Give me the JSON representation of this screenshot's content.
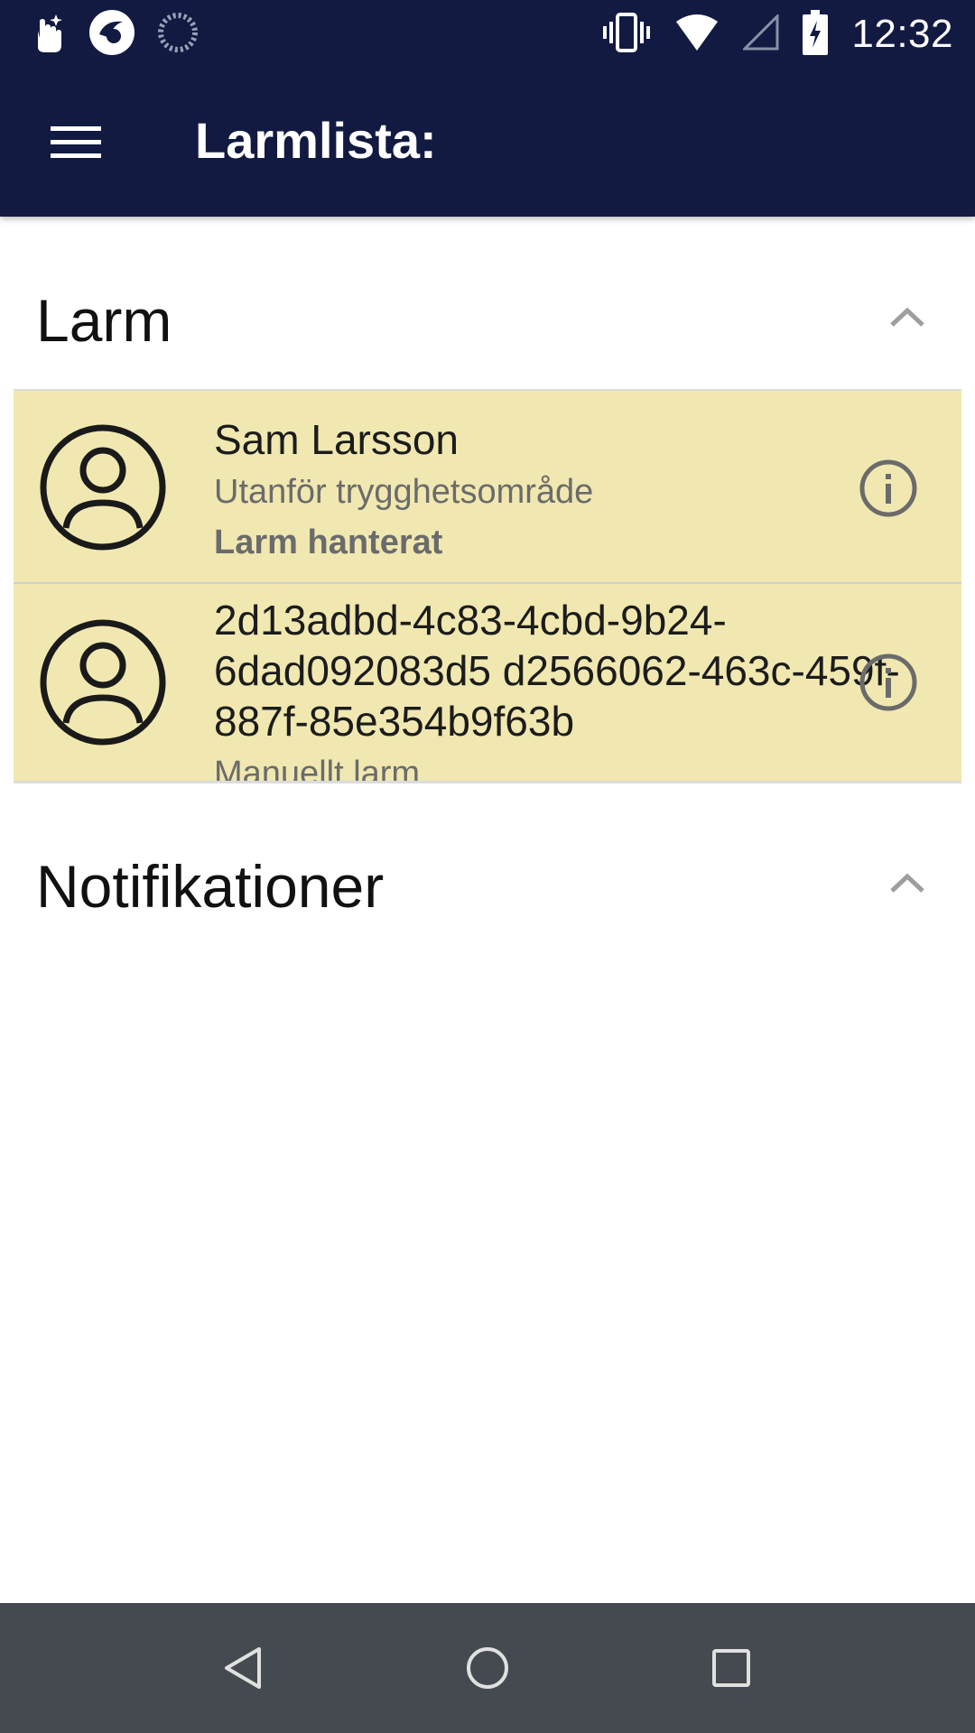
{
  "status_bar": {
    "time": "12:32",
    "icons_left": [
      "gesture-hand-icon",
      "app-logo-icon",
      "loading-circle-icon"
    ],
    "icons_right": [
      "vibrate-icon",
      "wifi-icon",
      "cellular-signal-icon",
      "battery-charging-icon"
    ]
  },
  "toolbar": {
    "title": "Larmlista:",
    "menu_icon": "hamburger-menu-icon"
  },
  "sections": {
    "alarms": {
      "title": "Larm",
      "chevron": "chevron-up-icon"
    },
    "notifications": {
      "title": "Notifikationer",
      "chevron": "chevron-up-icon"
    }
  },
  "alarms": [
    {
      "name": "Sam Larsson",
      "subtitle": "Utanför trygghetsområde",
      "status": "Larm hanterat",
      "avatar_icon": "user-avatar-icon",
      "info_icon": "info-icon"
    },
    {
      "name": "2d13adbd-4c83-4cbd-9b24-6dad092083d5 d2566062-463c-459f-887f-85e354b9f63b",
      "subtitle": "Manuellt larm",
      "avatar_icon": "user-avatar-icon",
      "info_icon": "info-icon"
    }
  ],
  "nav_bar": {
    "back_icon": "back-triangle-icon",
    "home_icon": "home-circle-icon",
    "recents_icon": "recents-square-icon"
  },
  "colors": {
    "app_bar": "#121a42",
    "alarm_background": "#f0e8b0",
    "nav_bar": "#454a50"
  }
}
